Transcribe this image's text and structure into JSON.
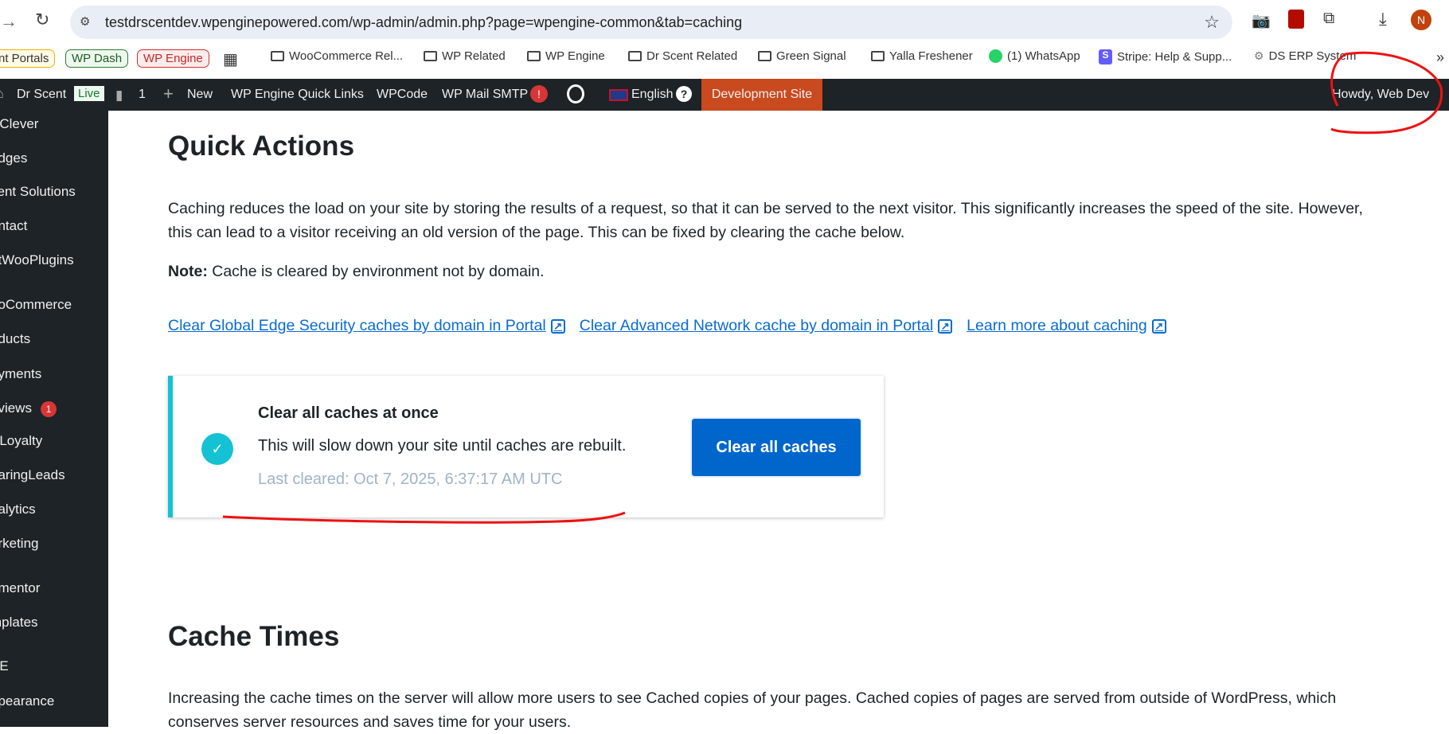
{
  "browser": {
    "url": "testdrscentdev.wpenginepowered.com/wp-admin/admin.php?page=wpengine-common&tab=caching",
    "profile_initial": "N",
    "bookmarks": [
      {
        "label": "nt Portals"
      },
      {
        "label": "WP Dash"
      },
      {
        "label": "WP Engine"
      },
      {
        "label": "WooCommerce Rel..."
      },
      {
        "label": "WP Related"
      },
      {
        "label": "WP Engine"
      },
      {
        "label": "Dr Scent Related"
      },
      {
        "label": "Green Signal"
      },
      {
        "label": "Yalla Freshener"
      },
      {
        "label": "(1) WhatsApp"
      },
      {
        "label": "Stripe: Help & Supp..."
      },
      {
        "label": "DS ERP System"
      }
    ],
    "more": "»"
  },
  "adminbar": {
    "site": "Dr Scent",
    "live": "Live",
    "comments": "1",
    "new": "New",
    "quick_links": "WP Engine Quick Links",
    "wpcode": "WPCode",
    "smtp": "WP Mail SMTP",
    "smtp_alert": "!",
    "language": "English",
    "help": "?",
    "dev_site": "Development Site",
    "howdy": "Howdy, Web Dev"
  },
  "sidebar": {
    "items": [
      "PClever",
      "adges",
      "cent Solutions",
      "ontact",
      "etWooPlugins",
      "ooCommerce",
      "oducts",
      "ayments",
      "eviews",
      "PLoyalty",
      "oaringLeads",
      "nalytics",
      "arketing",
      "ementor",
      "mplates",
      "AE",
      "ppearance"
    ],
    "reviews_badge": "1"
  },
  "main": {
    "quick_actions_title": "Quick Actions",
    "intro_line1": "Caching reduces the load on your site by storing the results of a request, so that it can be served to the next visitor. This significantly increases the speed of the site. However,",
    "intro_line2": "this can lead to a visitor receiving an old version of the page. This can be fixed by clearing the cache below.",
    "note_label": "Note:",
    "note_text": " Cache is cleared by environment not by domain.",
    "links": [
      "Clear Global Edge Security caches by domain in Portal",
      "Clear Advanced Network cache by domain in Portal",
      "Learn more about caching"
    ],
    "card": {
      "title": "Clear all caches at once",
      "desc": "This will slow down your site until caches are rebuilt.",
      "last_cleared": "Last cleared: Oct 7, 2025, 6:37:17 AM UTC",
      "button": "Clear all caches"
    },
    "cache_times_title": "Cache Times",
    "cache_line1": "Increasing the cache times on the server will allow more users to see Cached copies of your pages. Cached copies of pages are served from outside of WordPress, which",
    "cache_line2": "conserves server resources and saves time for your users."
  }
}
